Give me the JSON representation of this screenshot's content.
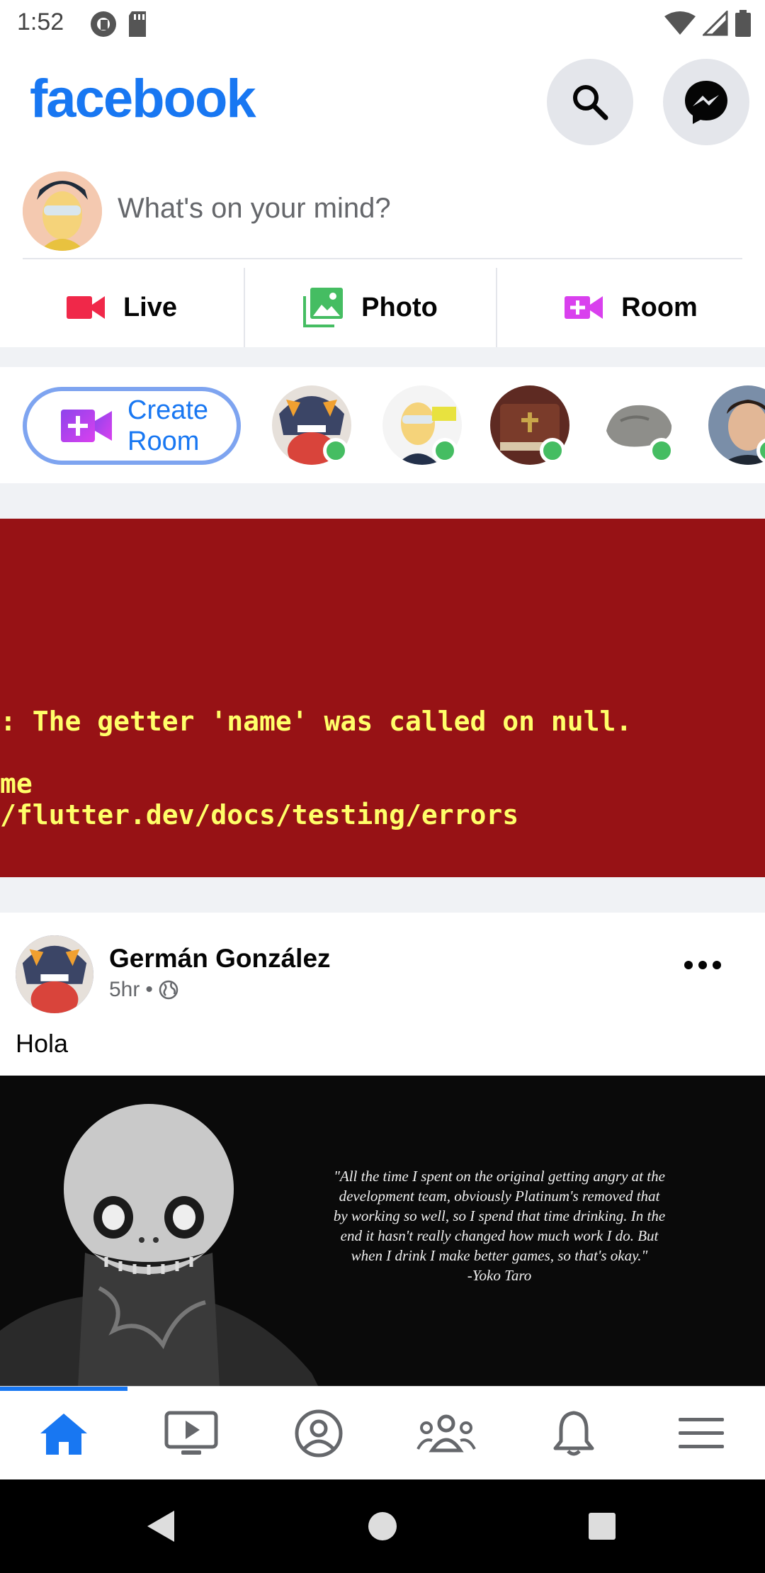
{
  "status_bar": {
    "time": "1:52",
    "left_icons": [
      "pocket-casts-icon",
      "sd-card-icon"
    ],
    "right_icons": [
      "wifi-icon",
      "cellular-signal-icon",
      "battery-icon"
    ]
  },
  "header": {
    "brand": "facebook",
    "brand_color": "#1877f2",
    "buttons": [
      "search-icon",
      "messenger-icon"
    ]
  },
  "composer": {
    "placeholder": "What's on your mind?",
    "actions": [
      {
        "label": "Live",
        "icon": "video-camera-icon",
        "color": "#f02849"
      },
      {
        "label": "Photo",
        "icon": "photo-icon",
        "color": "#45bd62"
      },
      {
        "label": "Room",
        "icon": "room-video-icon",
        "color": "#d940ee"
      }
    ]
  },
  "rooms": {
    "create_label": "Create Room",
    "online_color": "#45bd62"
  },
  "error": {
    "background": "#971215",
    "text_color": "#ffff69",
    "lines": [
      ": The getter 'name' was called on null.",
      "me",
      "/flutter.dev/docs/testing/errors"
    ]
  },
  "post": {
    "author": "Germán González",
    "time": "5hr",
    "separator": "•",
    "privacy_icon": "globe-icon",
    "text": "Hola",
    "image_quote": "\"All the time I spent on the original getting angry at the development team, obviously Platinum's removed that by working so well, so I spend that time drinking. In the end it hasn't really changed how much work I do. But when I drink I make better games, so that's okay.\"",
    "image_attribution": "-Yoko Taro"
  },
  "bottom_nav": {
    "items": [
      "home-icon",
      "watch-icon",
      "profile-icon",
      "groups-icon",
      "notifications-icon",
      "menu-icon"
    ],
    "active": "home-icon",
    "active_color": "#1877f2"
  },
  "system_nav": [
    "back-icon",
    "home-circle-icon",
    "recents-icon"
  ]
}
